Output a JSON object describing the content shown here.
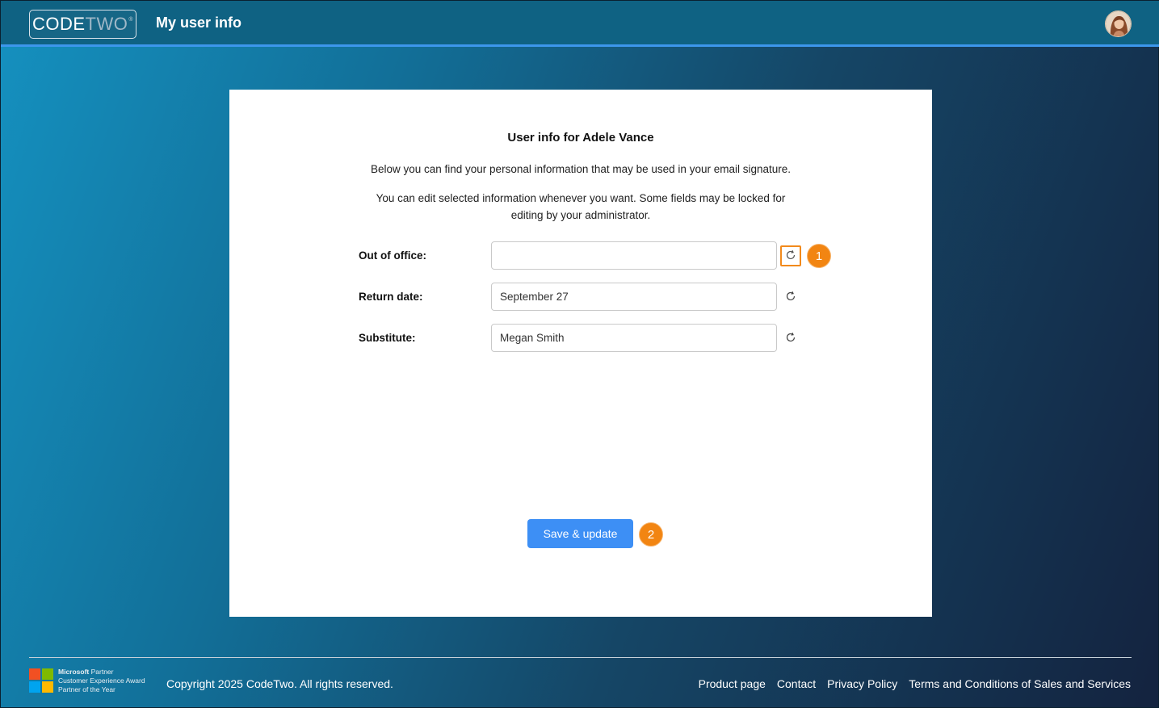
{
  "header": {
    "logo_code": "CODE",
    "logo_two": "TWO",
    "logo_reg": "®",
    "app_title": "My user info",
    "avatar_icon": "user-avatar-icon"
  },
  "card": {
    "title": "User info for Adele Vance",
    "description_1": "Below you can find your personal information that may be used in your email signature.",
    "description_2": "You can edit selected information whenever you want. Some fields may be locked for editing by your administrator.",
    "fields": [
      {
        "label": "Out of office:",
        "value": "",
        "placeholder": "",
        "reset_icon": "reset-icon"
      },
      {
        "label": "Return date:",
        "value": "September 27",
        "placeholder": "",
        "reset_icon": "reset-icon"
      },
      {
        "label": "Substitute:",
        "value": "Megan Smith",
        "placeholder": "",
        "reset_icon": "reset-icon"
      }
    ],
    "save_label": "Save & update",
    "markers": [
      "1",
      "2"
    ]
  },
  "footer": {
    "ms_partner_line1_bold": "Microsoft",
    "ms_partner_line1_rest": " Partner",
    "ms_partner_line2": "Customer Experience Award",
    "ms_partner_line3": "Partner of the Year",
    "copyright": "Copyright 2025 CodeTwo. All rights reserved.",
    "links": [
      "Product page",
      "Contact",
      "Privacy Policy",
      "Terms and Conditions of Sales and Services"
    ]
  },
  "colors": {
    "header_bg": "#0f6283",
    "header_accent": "#3d97ec",
    "primary_button": "#3d8ff5",
    "marker_orange": "#f28512",
    "ms_red": "#f25022",
    "ms_green": "#7fba00",
    "ms_blue": "#00a4ef",
    "ms_yellow": "#ffb900"
  }
}
